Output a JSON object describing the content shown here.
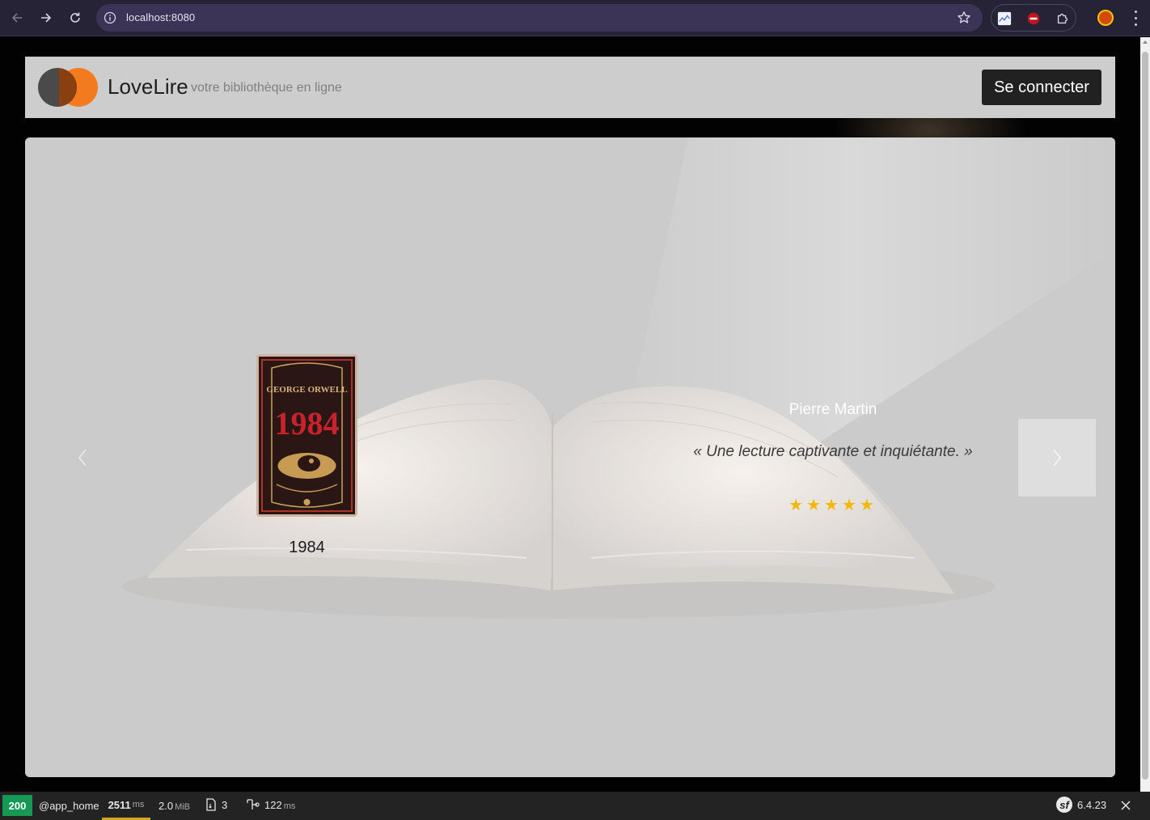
{
  "browser": {
    "url": "localhost:8080",
    "icons": [
      "back-arrow-icon",
      "forward-arrow-icon",
      "reload-icon",
      "site-info-icon",
      "bookmark-star-icon",
      "extension-icon",
      "puzzle-extensions-icon",
      "profile-avatar-icon",
      "kebab-menu-icon"
    ]
  },
  "header": {
    "brand": "LoveLire",
    "tagline": "votre bibliothèque en ligne",
    "login_label": "Se connecter"
  },
  "carousel": {
    "book_title": "1984",
    "cover_author": "GEORGE ORWELL",
    "cover_title": "1984",
    "reviewer": "Pierre Martin",
    "quote": "« Une lecture captivante et inquiétante. »",
    "stars": "★★★★★",
    "rating": 5,
    "rating_max": 5
  },
  "debug_toolbar": {
    "status": "200",
    "route": "@app_home",
    "time_value": "2511",
    "time_unit": "ms",
    "memory_value": "2.0",
    "memory_unit": "MiB",
    "files_count": "3",
    "ajax_value": "122",
    "ajax_unit": "ms",
    "symfony_version": "6.4.23"
  },
  "colors": {
    "chrome_bg": "#272336",
    "omnibox_bg": "#3c3456",
    "header_bg": "#cdcdcd",
    "login_btn_bg": "#212121",
    "logo_dark": "#4a4a4a",
    "logo_orange": "#f37a1f",
    "star_color": "#f5b800",
    "status_ok": "#159954",
    "toolbar_bg": "#232323"
  }
}
